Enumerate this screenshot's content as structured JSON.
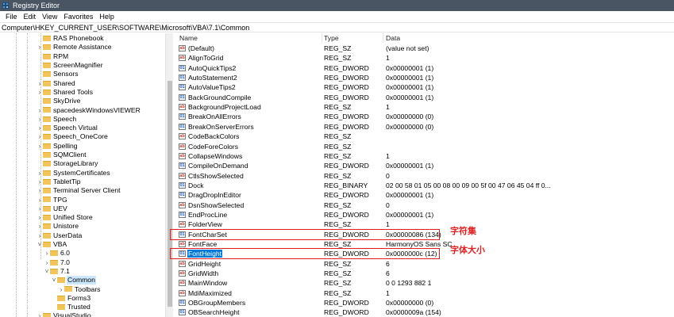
{
  "window": {
    "title": "Registry Editor"
  },
  "menu": [
    "File",
    "Edit",
    "View",
    "Favorites",
    "Help"
  ],
  "address": "Computer\\HKEY_CURRENT_USER\\SOFTWARE\\Microsoft\\VBA\\7.1\\Common",
  "tree": [
    {
      "label": "RAS Phonebook",
      "level": 0,
      "expander": ""
    },
    {
      "label": "Remote Assistance",
      "level": 0,
      "expander": ">"
    },
    {
      "label": "RPM",
      "level": 0,
      "expander": ""
    },
    {
      "label": "ScreenMagnifier",
      "level": 0,
      "expander": ""
    },
    {
      "label": "Sensors",
      "level": 0,
      "expander": ""
    },
    {
      "label": "Shared",
      "level": 0,
      "expander": ">"
    },
    {
      "label": "Shared Tools",
      "level": 0,
      "expander": ">"
    },
    {
      "label": "SkyDrive",
      "level": 0,
      "expander": ""
    },
    {
      "label": "spacedeskWindowsVIEWER",
      "level": 0,
      "expander": ">"
    },
    {
      "label": "Speech",
      "level": 0,
      "expander": ">"
    },
    {
      "label": "Speech Virtual",
      "level": 0,
      "expander": ">"
    },
    {
      "label": "Speech_OneCore",
      "level": 0,
      "expander": ">"
    },
    {
      "label": "Spelling",
      "level": 0,
      "expander": ">"
    },
    {
      "label": "SQMClient",
      "level": 0,
      "expander": ""
    },
    {
      "label": "StorageLibrary",
      "level": 0,
      "expander": ""
    },
    {
      "label": "SystemCertificates",
      "level": 0,
      "expander": ">"
    },
    {
      "label": "TabletTip",
      "level": 0,
      "expander": ">"
    },
    {
      "label": "Terminal Server Client",
      "level": 0,
      "expander": ">"
    },
    {
      "label": "TPG",
      "level": 0,
      "expander": ">"
    },
    {
      "label": "UEV",
      "level": 0,
      "expander": ">"
    },
    {
      "label": "Unified Store",
      "level": 0,
      "expander": ">"
    },
    {
      "label": "Unistore",
      "level": 0,
      "expander": ">"
    },
    {
      "label": "UserData",
      "level": 0,
      "expander": ">"
    },
    {
      "label": "VBA",
      "level": 0,
      "expander": "v"
    },
    {
      "label": "6.0",
      "level": 1,
      "expander": ">"
    },
    {
      "label": "7.0",
      "level": 1,
      "expander": ">"
    },
    {
      "label": "7.1",
      "level": 1,
      "expander": "v"
    },
    {
      "label": "Common",
      "level": 2,
      "expander": "v",
      "selected": true
    },
    {
      "label": "Toolbars",
      "level": 3,
      "expander": ">"
    },
    {
      "label": "Forms3",
      "level": 2,
      "expander": ""
    },
    {
      "label": "Trusted",
      "level": 2,
      "expander": ""
    },
    {
      "label": "VisualStudio",
      "level": 0,
      "expander": ">"
    }
  ],
  "columns": {
    "name": "Name",
    "type": "Type",
    "data": "Data"
  },
  "values": [
    {
      "name": "(Default)",
      "type": "REG_SZ",
      "data": "(value not set)",
      "icon": "sz"
    },
    {
      "name": "AlignToGrid",
      "type": "REG_SZ",
      "data": "1",
      "icon": "sz"
    },
    {
      "name": "AutoQuickTips2",
      "type": "REG_DWORD",
      "data": "0x00000001 (1)",
      "icon": "bin"
    },
    {
      "name": "AutoStatement2",
      "type": "REG_DWORD",
      "data": "0x00000001 (1)",
      "icon": "bin"
    },
    {
      "name": "AutoValueTips2",
      "type": "REG_DWORD",
      "data": "0x00000001 (1)",
      "icon": "bin"
    },
    {
      "name": "BackGroundCompile",
      "type": "REG_DWORD",
      "data": "0x00000001 (1)",
      "icon": "bin"
    },
    {
      "name": "BackgroundProjectLoad",
      "type": "REG_SZ",
      "data": "1",
      "icon": "sz"
    },
    {
      "name": "BreakOnAllErrors",
      "type": "REG_DWORD",
      "data": "0x00000000 (0)",
      "icon": "bin"
    },
    {
      "name": "BreakOnServerErrors",
      "type": "REG_DWORD",
      "data": "0x00000000 (0)",
      "icon": "bin"
    },
    {
      "name": "CodeBackColors",
      "type": "REG_SZ",
      "data": "",
      "icon": "sz"
    },
    {
      "name": "CodeForeColors",
      "type": "REG_SZ",
      "data": "",
      "icon": "sz"
    },
    {
      "name": "CollapseWindows",
      "type": "REG_SZ",
      "data": "1",
      "icon": "sz"
    },
    {
      "name": "CompileOnDemand",
      "type": "REG_DWORD",
      "data": "0x00000001 (1)",
      "icon": "bin"
    },
    {
      "name": "CtlsShowSelected",
      "type": "REG_SZ",
      "data": "0",
      "icon": "sz"
    },
    {
      "name": "Dock",
      "type": "REG_BINARY",
      "data": "02 00 58 01 05 00 08 00 09 00 5f 00 47 06 45 04 ff 0...",
      "icon": "bin"
    },
    {
      "name": "DragDropInEditor",
      "type": "REG_DWORD",
      "data": "0x00000001 (1)",
      "icon": "bin"
    },
    {
      "name": "DsnShowSelected",
      "type": "REG_SZ",
      "data": "0",
      "icon": "sz"
    },
    {
      "name": "EndProcLine",
      "type": "REG_DWORD",
      "data": "0x00000001 (1)",
      "icon": "bin"
    },
    {
      "name": "FolderView",
      "type": "REG_SZ",
      "data": "1",
      "icon": "sz"
    },
    {
      "name": "FontCharSet",
      "type": "REG_DWORD",
      "data": "0x00000086 (134)",
      "icon": "bin"
    },
    {
      "name": "FontFace",
      "type": "REG_SZ",
      "data": "HarmonyOS Sans SC",
      "icon": "sz"
    },
    {
      "name": "FontHeight",
      "type": "REG_DWORD",
      "data": "0x0000000c (12)",
      "icon": "bin",
      "selected": true
    },
    {
      "name": "GridHeight",
      "type": "REG_SZ",
      "data": "6",
      "icon": "sz"
    },
    {
      "name": "GridWidth",
      "type": "REG_SZ",
      "data": "6",
      "icon": "sz"
    },
    {
      "name": "MainWindow",
      "type": "REG_SZ",
      "data": "0 0 1293 882 1",
      "icon": "sz"
    },
    {
      "name": "MdiMaximized",
      "type": "REG_SZ",
      "data": "1",
      "icon": "sz"
    },
    {
      "name": "OBGroupMembers",
      "type": "REG_DWORD",
      "data": "0x00000000 (0)",
      "icon": "bin"
    },
    {
      "name": "OBSearchHeight",
      "type": "REG_DWORD",
      "data": "0x0000009a (154)",
      "icon": "bin"
    }
  ],
  "annotations": [
    {
      "text": "字符集",
      "target": "FontCharSet"
    },
    {
      "text": "字体大小",
      "target": "FontHeight"
    }
  ],
  "colors": {
    "annotation": "#e02020",
    "selection": "#0078d7",
    "tree_selection": "#cce8ff",
    "titlebar": "#4a5563"
  },
  "icons": {
    "app": "registry-icon",
    "folder": "folder-icon",
    "string_value": "reg-sz-icon",
    "binary_value": "reg-binary-icon"
  }
}
